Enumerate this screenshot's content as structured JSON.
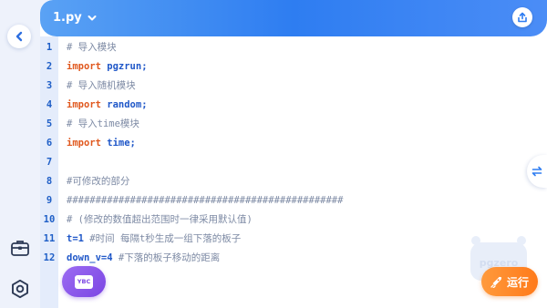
{
  "file_tab": {
    "name": "1.py"
  },
  "code_lines": [
    {
      "num": "1",
      "text": "# 导入模块",
      "kind": "comment"
    },
    {
      "num": "2",
      "keyword": "import",
      "ident": "pgzrun;",
      "kind": "import"
    },
    {
      "num": "3",
      "text": "# 导入随机模块",
      "kind": "comment"
    },
    {
      "num": "4",
      "keyword": "import",
      "ident": "random;",
      "kind": "import"
    },
    {
      "num": "5",
      "text": "# 导入time模块",
      "kind": "comment"
    },
    {
      "num": "6",
      "keyword": "import",
      "ident": "time;",
      "kind": "import"
    },
    {
      "num": "7",
      "text": "",
      "kind": "blank"
    },
    {
      "num": "8",
      "text": "#可修改的部分",
      "kind": "comment"
    },
    {
      "num": "9",
      "text": "################################################",
      "kind": "hashline"
    },
    {
      "num": "10",
      "text": "# (修改的数值超出范围时一律采用默认值)",
      "kind": "comment"
    },
    {
      "num": "11",
      "keyword": "t=1",
      "ident": "#时间 每隔t秒生成一组下落的板子",
      "kind": "assign"
    },
    {
      "num": "12",
      "keyword": "down_v=4",
      "ident": "#下落的板子移动的距离",
      "kind": "assign"
    }
  ],
  "ybc_button": {
    "label": "YBC"
  },
  "run_button": {
    "label": "运行"
  },
  "watermark": {
    "text": "pgzero"
  },
  "icons": {
    "back": "chevron-left-icon",
    "share": "share-upload-icon",
    "swap": "swap-arrows-icon",
    "toolbox": "toolbox-icon",
    "settings": "hexagon-settings-icon",
    "run": "rocket-icon",
    "dropdown": "chevron-down-icon"
  },
  "colors": {
    "accent_blue": "#2e7df1",
    "keyword_orange": "#e0581e",
    "ident_blue": "#1f57c8",
    "comment_gray": "#7d8aa4",
    "run_orange": "#ff7a1a",
    "ybc_purple": "#7b45e3"
  }
}
